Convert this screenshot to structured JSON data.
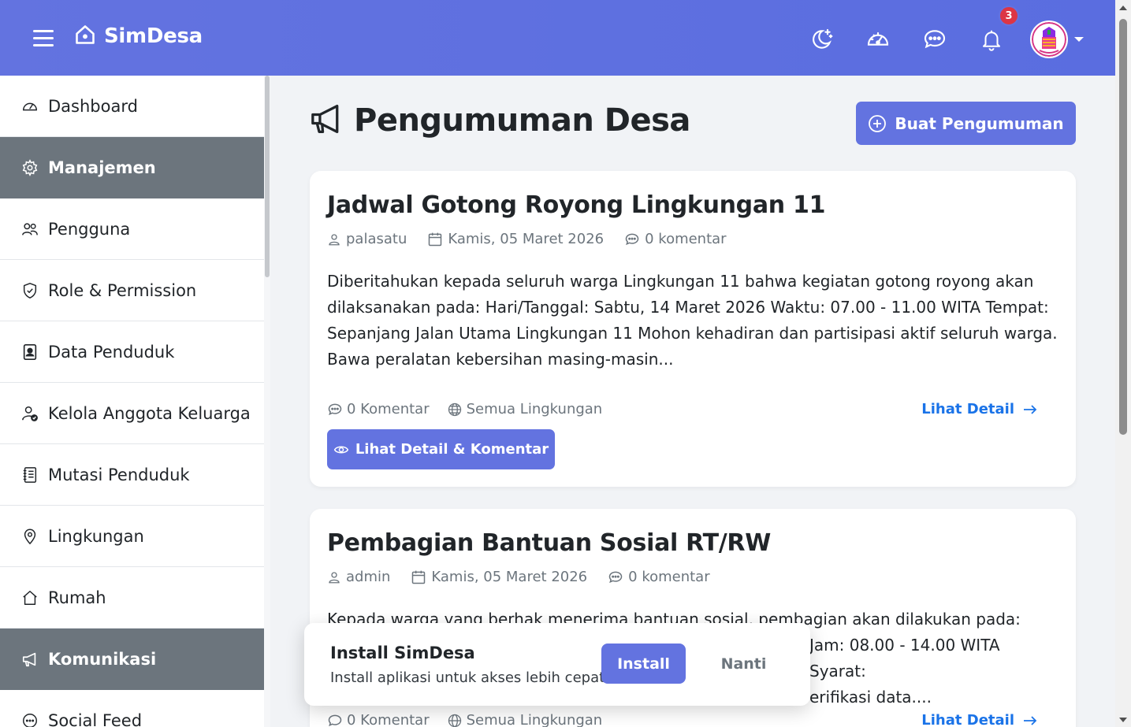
{
  "app": {
    "brand": "SimDesa"
  },
  "topbar": {
    "notification_count": "3"
  },
  "sidebar": {
    "items": [
      {
        "label": "Dashboard",
        "icon": "gauge-icon",
        "section": false
      },
      {
        "label": "Manajemen",
        "icon": "gear-icon",
        "section": true
      },
      {
        "label": "Pengguna",
        "icon": "users-icon",
        "section": false
      },
      {
        "label": "Role & Permission",
        "icon": "shield-icon",
        "section": false
      },
      {
        "label": "Data Penduduk",
        "icon": "id-card-icon",
        "section": false
      },
      {
        "label": "Kelola Anggota Keluarga",
        "icon": "user-check-icon",
        "section": false
      },
      {
        "label": "Mutasi Penduduk",
        "icon": "journal-icon",
        "section": false
      },
      {
        "label": "Lingkungan",
        "icon": "map-pin-icon",
        "section": false
      },
      {
        "label": "Rumah",
        "icon": "house-icon",
        "section": false
      },
      {
        "label": "Komunikasi",
        "icon": "megaphone-icon",
        "section": true
      },
      {
        "label": "Social Feed",
        "icon": "chat-icon",
        "section": false
      }
    ]
  },
  "main": {
    "title": "Pengumuman Desa",
    "create_button": "Buat Pengumuman",
    "announcements": [
      {
        "title": "Jadwal Gotong Royong Lingkungan 11",
        "author": "palasatu",
        "date": "Kamis, 05 Maret 2026",
        "comments": "0 komentar",
        "body_lines": [
          "Diberitahukan kepada seluruh warga Lingkungan 11 bahwa kegiatan gotong royong akan",
          "dilaksanakan pada: Hari/Tanggal: Sabtu, 14 Maret 2026 Waktu: 07.00 - 11.00 WITA Tempat:",
          "Sepanjang Jalan Utama Lingkungan 11 Mohon kehadiran dan partisipasi aktif seluruh warga.",
          "Bawa peralatan kebersihan masing-masin..."
        ],
        "footer_comments": "0 Komentar",
        "scope": "Semua Lingkungan",
        "detail_link": "Lihat Detail",
        "detail_button": "Lihat Detail & Komentar"
      },
      {
        "title": "Pembagian Bantuan Sosial RT/RW",
        "author": "admin",
        "date": "Kamis, 05 Maret 2026",
        "comments": "0 komentar",
        "body_lines": [
          "Kepada warga yang berhak menerima bantuan sosial, pembagian akan dilakukan pada:",
          "Jam: 08.00 - 14.00 WITA Syarat:",
          "erifikasi data...."
        ],
        "footer_comments": "0 Komentar",
        "scope": "Semua Lingkungan",
        "detail_link": "Lihat Detail"
      }
    ]
  },
  "install_prompt": {
    "title": "Install SimDesa",
    "subtitle": "Install aplikasi untuk akses lebih cepat",
    "install_label": "Install",
    "later_label": "Nanti"
  },
  "colors": {
    "primary": "#6373e0",
    "section": "#6c757d",
    "link": "#1a73e8",
    "badge": "#dc3545"
  }
}
